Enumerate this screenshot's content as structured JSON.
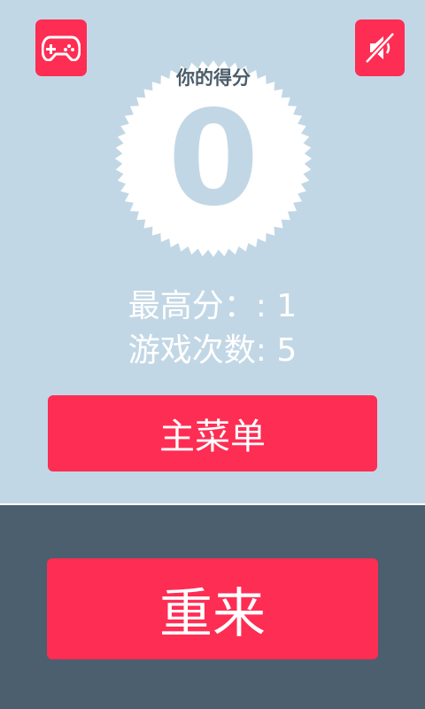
{
  "header": {
    "left_icon": "gamepad-icon",
    "right_icon": "sound-muted-icon"
  },
  "score_badge": {
    "title": "你的得分",
    "score": "0"
  },
  "stats": {
    "best_score": "最高分：: 1",
    "games_played": "游戏次数: 5"
  },
  "buttons": {
    "main_menu": "主菜单",
    "retry": "重来"
  },
  "colors": {
    "background": "#c2d7e5",
    "accent": "#fe2d53",
    "panel": "#4b5f6e",
    "badge": "#ffffff",
    "badge_text": "#4a5c6b"
  }
}
